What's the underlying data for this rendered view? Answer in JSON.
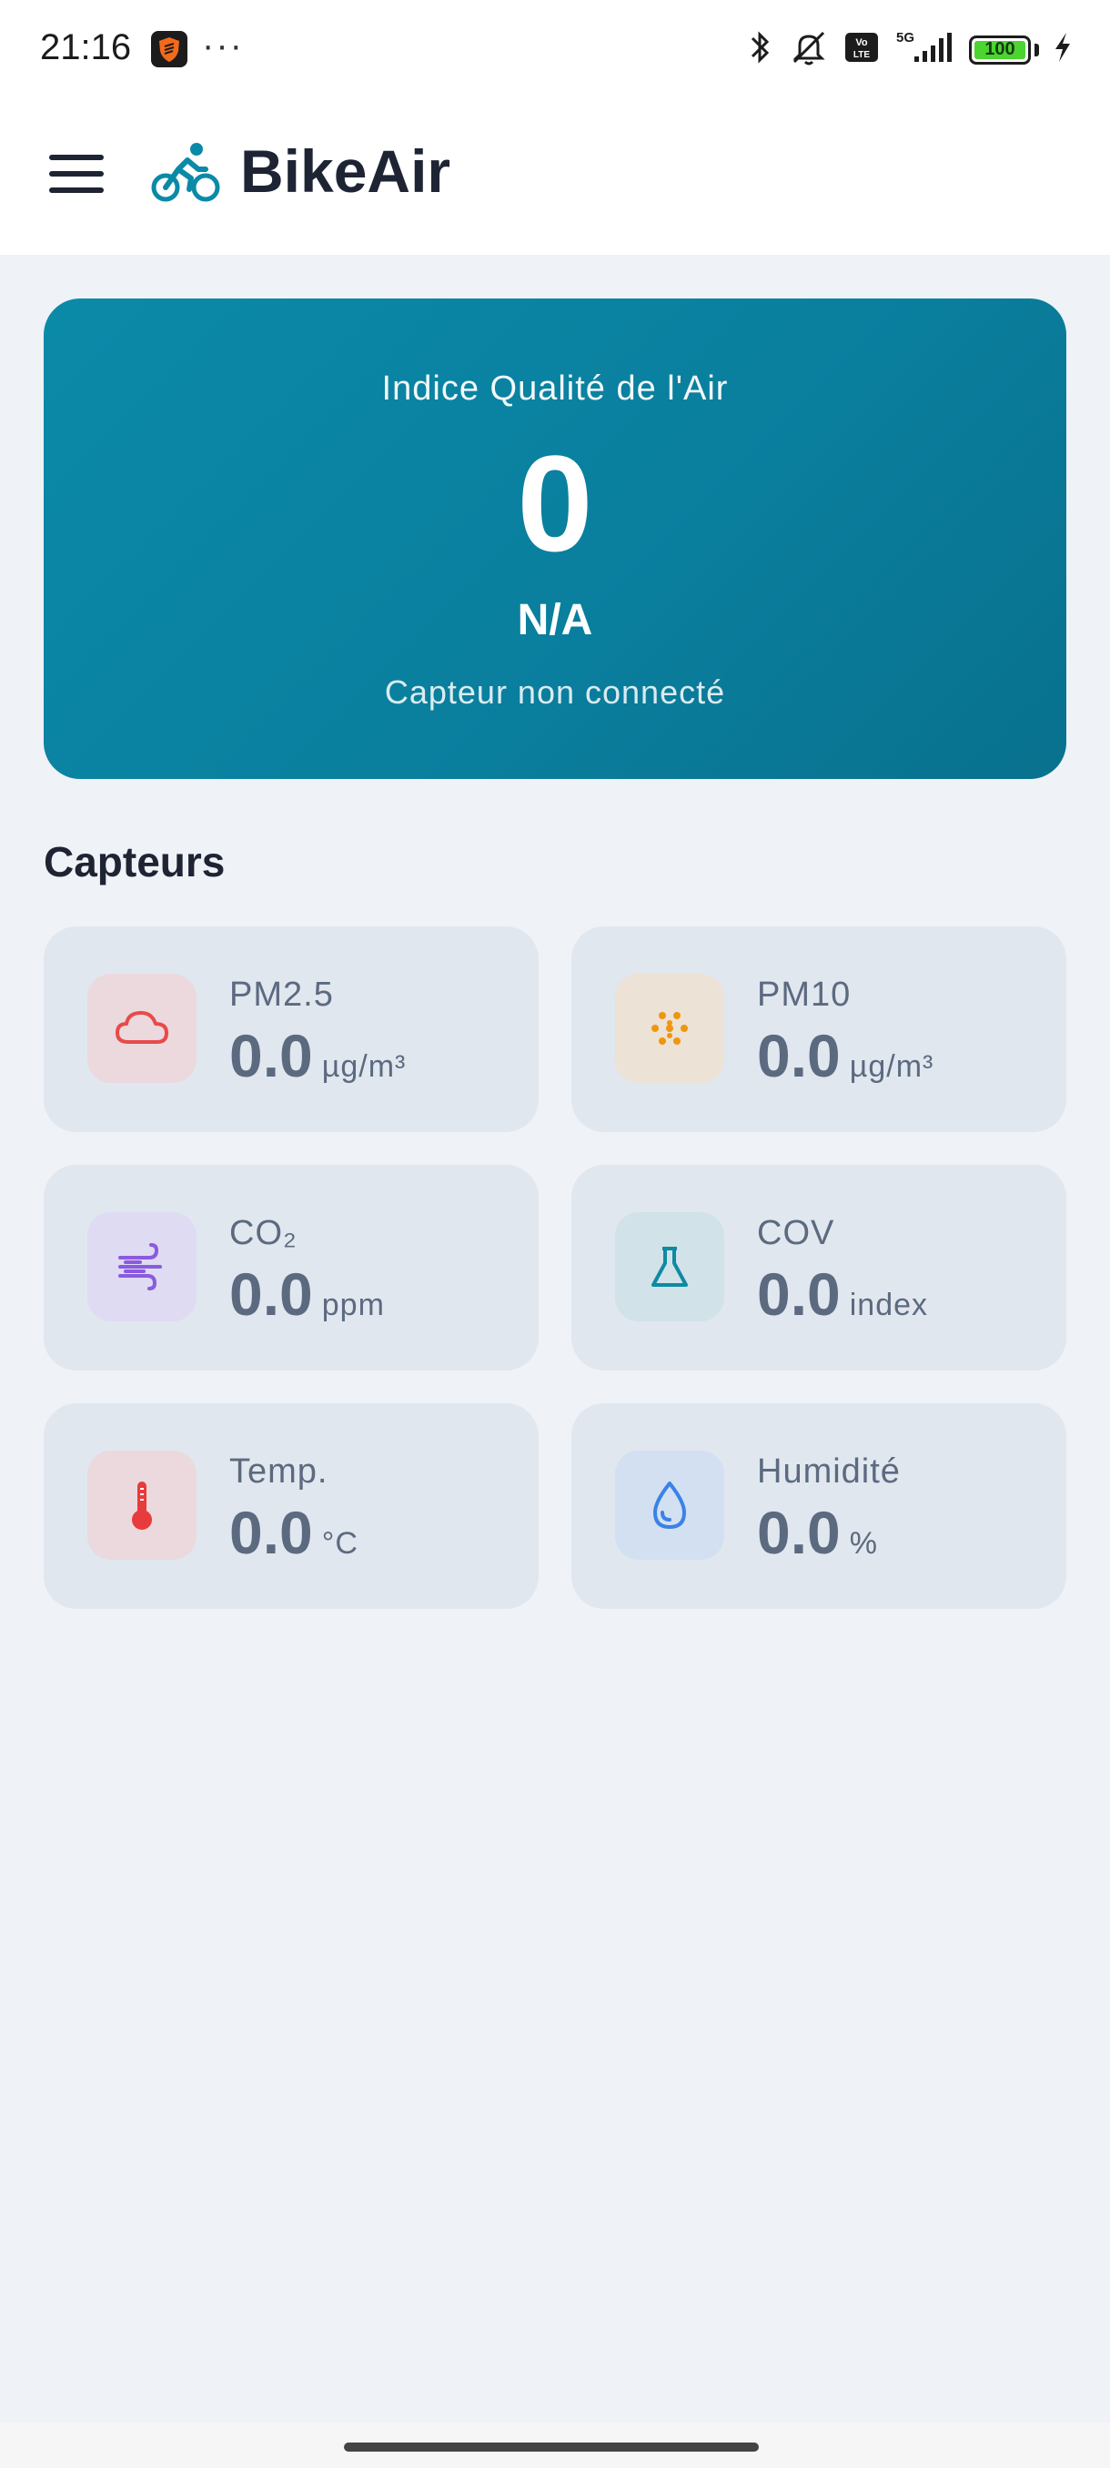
{
  "status_bar": {
    "time": "21:16",
    "more": "···",
    "battery": "100",
    "icons": [
      "bluetooth-icon",
      "silent-icon",
      "volte-icon",
      "5g-signal-icon",
      "battery-icon",
      "charging-icon"
    ]
  },
  "appbar": {
    "title": "BikeAir",
    "menu_icon": "hamburger-icon",
    "logo_icon": "bicycle-rider-icon",
    "brand_color": "#0b8aa8"
  },
  "aqi": {
    "label": "Indice Qualité de l'Air",
    "value": "0",
    "level": "N/A",
    "status": "Capteur non connecté"
  },
  "sensors_section": {
    "title": "Capteurs",
    "items": [
      {
        "name": "PM2.5",
        "value": "0.0",
        "unit": "µg/m³",
        "icon": "cloud-icon",
        "icon_color": "#e84a4a",
        "icon_bg": "#ebd9de"
      },
      {
        "name": "PM10",
        "value": "0.0",
        "unit": "µg/m³",
        "icon": "particles-icon",
        "icon_color": "#f0960e",
        "icon_bg": "#ece2d6"
      },
      {
        "name": "CO₂",
        "value": "0.0",
        "unit": "ppm",
        "icon": "wind-icon",
        "icon_color": "#8a5be0",
        "icon_bg": "#dfdbf2"
      },
      {
        "name": "COV",
        "value": "0.0",
        "unit": "index",
        "icon": "flask-icon",
        "icon_color": "#0e8aa3",
        "icon_bg": "#d1e2e9"
      },
      {
        "name": "Temp.",
        "value": "0.0",
        "unit": "°C",
        "icon": "thermometer-icon",
        "icon_color": "#e83b3b",
        "icon_bg": "#ebd9de"
      },
      {
        "name": "Humidité",
        "value": "0.0",
        "unit": "%",
        "icon": "droplet-icon",
        "icon_color": "#3a82e6",
        "icon_bg": "#d3e0f2"
      }
    ]
  }
}
